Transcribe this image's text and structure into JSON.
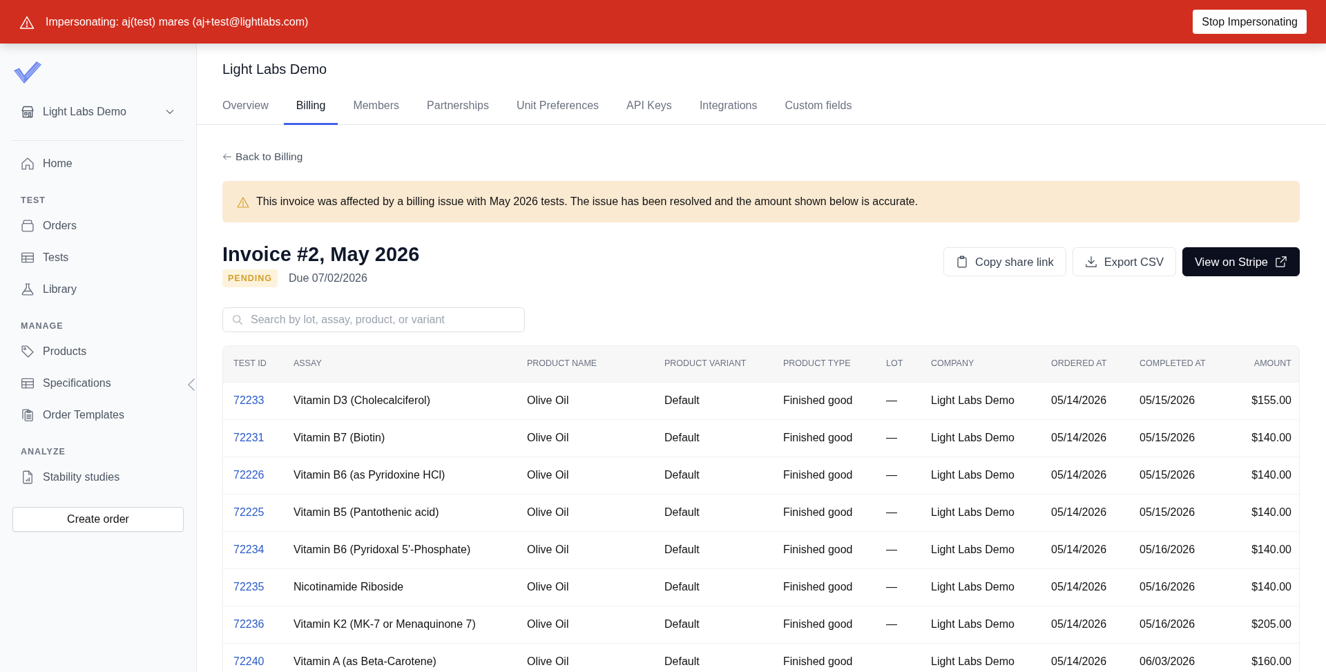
{
  "banner": {
    "message": "Impersonating: aj(test) mares (aj+test@lightlabs.com)",
    "button": "Stop Impersonating"
  },
  "sidebar": {
    "organization": "Light Labs Demo",
    "home": "Home",
    "sections": [
      {
        "heading": "TEST",
        "items": [
          "Orders",
          "Tests",
          "Library"
        ]
      },
      {
        "heading": "MANAGE",
        "items": [
          "Products",
          "Specifications",
          "Order Templates"
        ]
      },
      {
        "heading": "ANALYZE",
        "items": [
          "Stability studies"
        ]
      }
    ],
    "button": "Create order"
  },
  "page": {
    "title": "Light Labs Demo",
    "tabs": [
      {
        "label": "Overview",
        "selected": false
      },
      {
        "label": "Billing",
        "selected": true
      },
      {
        "label": "Members",
        "selected": false
      },
      {
        "label": "Partnerships",
        "selected": false
      },
      {
        "label": "Unit Preferences",
        "selected": false
      },
      {
        "label": "API Keys",
        "selected": false
      },
      {
        "label": "Integrations",
        "selected": false
      },
      {
        "label": "Custom fields",
        "selected": false
      }
    ],
    "back_link": "Back to Billing",
    "alert": "This invoice was affected by a billing issue with May 2026 tests. The issue has been resolved and the amount shown below is accurate.",
    "invoice": {
      "title": "Invoice #2, May 2026",
      "status": "PENDING",
      "due": "Due 07/02/2026"
    },
    "actions": [
      {
        "label": "Copy share link",
        "kind": "secondary"
      },
      {
        "label": "Export CSV",
        "kind": "secondary"
      },
      {
        "label": "View on Stripe",
        "kind": "primary"
      }
    ],
    "search": {
      "placeholder": "Search by lot, assay, product, or variant"
    },
    "table": {
      "columns": [
        "TEST ID",
        "ASSAY",
        "PRODUCT NAME",
        "PRODUCT VARIANT",
        "PRODUCT TYPE",
        "LOT",
        "COMPANY",
        "ORDERED AT",
        "COMPLETED AT",
        "AMOUNT"
      ],
      "rows": [
        {
          "test_id": "72233",
          "assay": "Vitamin D3 (Cholecalciferol)",
          "product_name": "Olive Oil",
          "product_variant": "Default",
          "product_type": "Finished good",
          "lot": "—",
          "company": "Light Labs Demo",
          "ordered_at": "05/14/2026",
          "completed_at": "05/15/2026",
          "amount": "$155.00"
        },
        {
          "test_id": "72231",
          "assay": "Vitamin B7 (Biotin)",
          "product_name": "Olive Oil",
          "product_variant": "Default",
          "product_type": "Finished good",
          "lot": "—",
          "company": "Light Labs Demo",
          "ordered_at": "05/14/2026",
          "completed_at": "05/15/2026",
          "amount": "$140.00"
        },
        {
          "test_id": "72226",
          "assay": "Vitamin B6 (as Pyridoxine HCl)",
          "product_name": "Olive Oil",
          "product_variant": "Default",
          "product_type": "Finished good",
          "lot": "—",
          "company": "Light Labs Demo",
          "ordered_at": "05/14/2026",
          "completed_at": "05/15/2026",
          "amount": "$140.00"
        },
        {
          "test_id": "72225",
          "assay": "Vitamin B5 (Pantothenic acid)",
          "product_name": "Olive Oil",
          "product_variant": "Default",
          "product_type": "Finished good",
          "lot": "—",
          "company": "Light Labs Demo",
          "ordered_at": "05/14/2026",
          "completed_at": "05/15/2026",
          "amount": "$140.00"
        },
        {
          "test_id": "72234",
          "assay": "Vitamin B6 (Pyridoxal 5'-Phosphate)",
          "product_name": "Olive Oil",
          "product_variant": "Default",
          "product_type": "Finished good",
          "lot": "—",
          "company": "Light Labs Demo",
          "ordered_at": "05/14/2026",
          "completed_at": "05/16/2026",
          "amount": "$140.00"
        },
        {
          "test_id": "72235",
          "assay": "Nicotinamide Riboside",
          "product_name": "Olive Oil",
          "product_variant": "Default",
          "product_type": "Finished good",
          "lot": "—",
          "company": "Light Labs Demo",
          "ordered_at": "05/14/2026",
          "completed_at": "05/16/2026",
          "amount": "$140.00"
        },
        {
          "test_id": "72236",
          "assay": "Vitamin K2 (MK-7 or Menaquinone 7)",
          "product_name": "Olive Oil",
          "product_variant": "Default",
          "product_type": "Finished good",
          "lot": "—",
          "company": "Light Labs Demo",
          "ordered_at": "05/14/2026",
          "completed_at": "05/16/2026",
          "amount": "$205.00"
        },
        {
          "test_id": "72240",
          "assay": "Vitamin A (as Beta-Carotene)",
          "product_name": "Olive Oil",
          "product_variant": "Default",
          "product_type": "Finished good",
          "company": "Light Labs Demo",
          "ordered_at": "05/14/2026",
          "completed_at": "06/03/2026",
          "amount": "$160.00"
        }
      ]
    }
  }
}
